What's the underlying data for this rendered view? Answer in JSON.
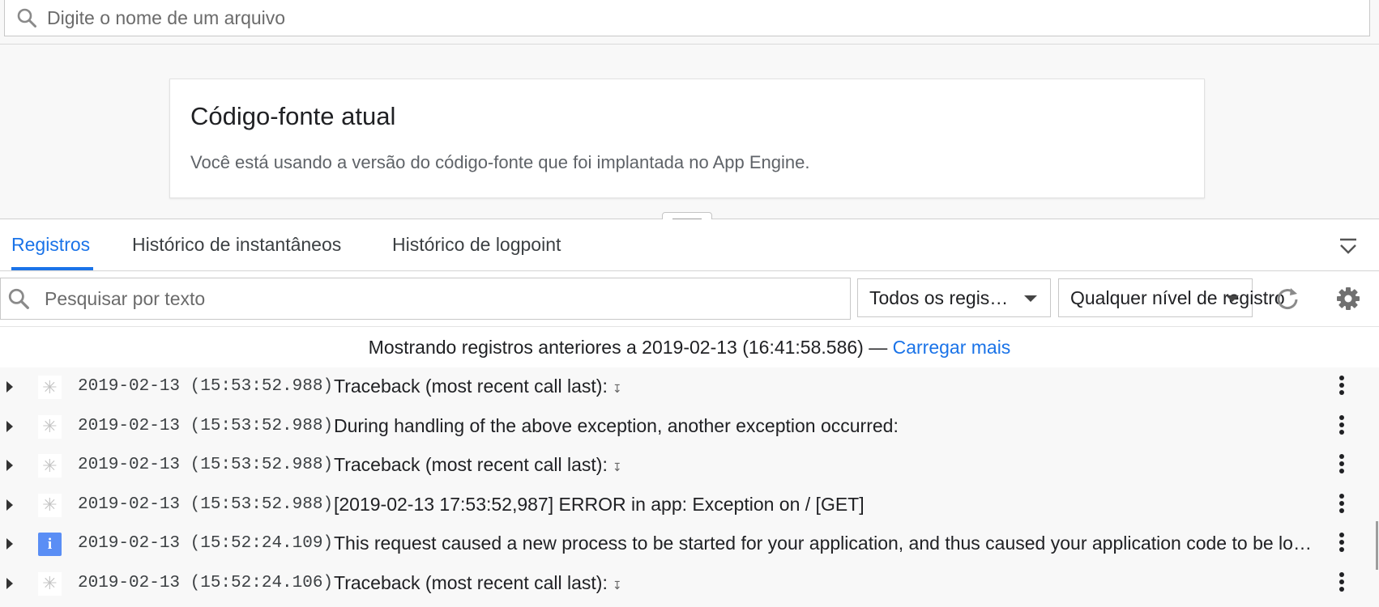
{
  "file_search": {
    "placeholder": "Digite o nome de um arquivo",
    "icon": "search-icon"
  },
  "card": {
    "title": "Código-fonte atual",
    "text": "Você está usando a versão do código-fonte que foi implantada no App Engine."
  },
  "tabs": [
    {
      "label": "Registros",
      "active": true
    },
    {
      "label": "Histórico de instantâneos",
      "active": false
    },
    {
      "label": "Histórico de logpoint",
      "active": false
    }
  ],
  "toolbar": {
    "search_placeholder": "Pesquisar por texto",
    "log_source": "Todos os regis…",
    "log_level": "Qualquer nível de registro"
  },
  "info": {
    "prefix": "Mostrando registros anteriores a 2019-02-13 (16:41:58.586) —",
    "link": "Carregar mais"
  },
  "rows": [
    {
      "severity": "any",
      "timestamp": "2019-02-13 (15:53:52.988)",
      "message": "Traceback (most recent call last):",
      "marker": "↧"
    },
    {
      "severity": "any",
      "timestamp": "2019-02-13 (15:53:52.988)",
      "message": "During handling of the above exception, another exception occurred:",
      "marker": ""
    },
    {
      "severity": "any",
      "timestamp": "2019-02-13 (15:53:52.988)",
      "message": "Traceback (most recent call last):",
      "marker": "↧"
    },
    {
      "severity": "any",
      "timestamp": "2019-02-13 (15:53:52.988)",
      "message": "[2019-02-13 17:53:52,987] ERROR in app: Exception on / [GET]",
      "marker": ""
    },
    {
      "severity": "info",
      "timestamp": "2019-02-13 (15:52:24.109)",
      "message": "This request caused a new process to be started for your application, and thus caused your application code to be loaded for the first time. This request may thus take longer and use more CPU than a typical request for your application.",
      "marker": ""
    },
    {
      "severity": "any",
      "timestamp": "2019-02-13 (15:52:24.106)",
      "message": "Traceback (most recent call last):",
      "marker": "↧"
    }
  ],
  "severity_glyphs": {
    "any": "✳",
    "info": "i"
  },
  "colors": {
    "accent": "#1a73e8",
    "info_badge": "#5a8ef5"
  }
}
